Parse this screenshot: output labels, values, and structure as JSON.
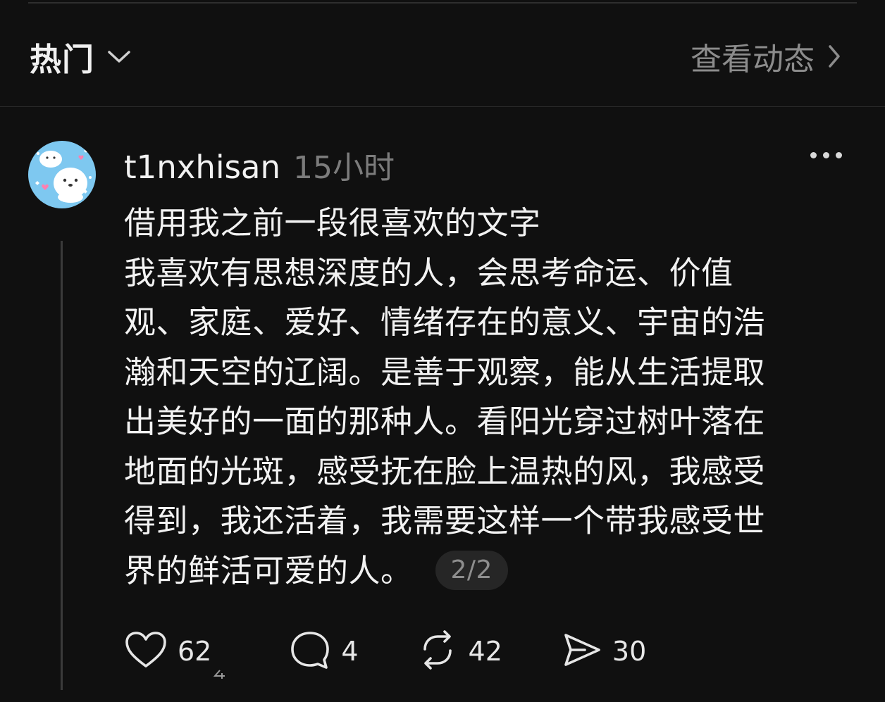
{
  "header": {
    "feed_title": "热门",
    "view_activity": "查看动态"
  },
  "post": {
    "username": "t1nxhisan",
    "time": "15小时",
    "text_lines": [
      "借用我之前一段很喜欢的文字",
      "我喜欢有思想深度的人，会思考命运、价值",
      "观、家庭、爱好、情绪存在的意义、宇宙的浩",
      "瀚和天空的辽阔。是善于观察，能从生活提取",
      "出美好的一面的那种人。看阳光穿过树叶落在",
      "地面的光斑，感受抚在脸上温热的风，我感受",
      "得到，我还活着，我需要这样一个带我感受世",
      "界的鲜活可爱的人。"
    ],
    "page_indicator": "2/2",
    "stats": {
      "likes": "62",
      "comments": "4",
      "reposts": "42",
      "shares": "30"
    }
  },
  "icons": [
    "chevron-down-icon",
    "chevron-right-icon",
    "avatar",
    "more-icon",
    "heart-icon",
    "comment-icon",
    "repost-icon",
    "share-icon"
  ],
  "colors": {
    "background": "#101010",
    "text_primary": "#f2f2f2",
    "text_secondary": "#8c8c8c",
    "badge_bg": "#262626",
    "avatar_bg": "#7ec8f0"
  }
}
